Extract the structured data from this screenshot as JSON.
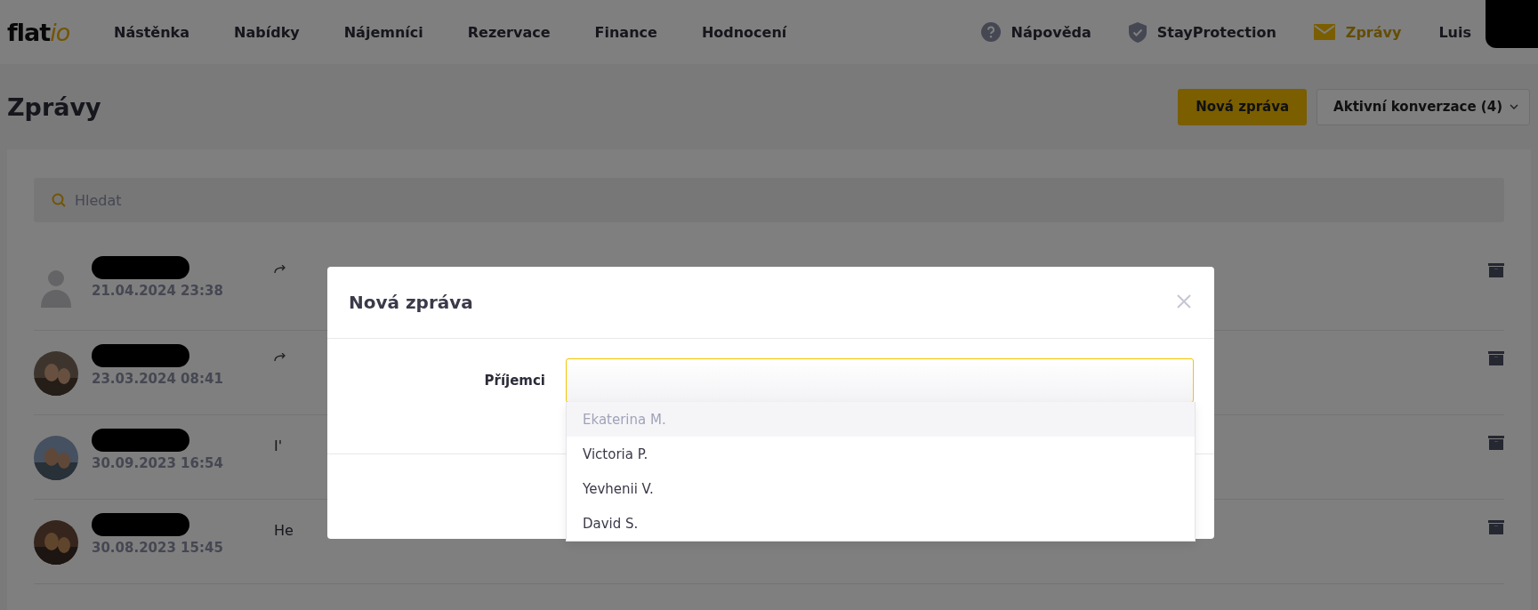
{
  "logo": {
    "main": "flat",
    "accent": "io"
  },
  "nav_links": [
    {
      "label": "Nástěnka",
      "selected": false
    },
    {
      "label": "Nabídky",
      "selected": false
    },
    {
      "label": "Nájemníci",
      "selected": false
    },
    {
      "label": "Rezervace",
      "selected": false
    },
    {
      "label": "Finance",
      "selected": false
    },
    {
      "label": "Hodnocení",
      "selected": false
    }
  ],
  "nav_right": [
    {
      "label": "Nápověda",
      "kind": "help",
      "selected": false
    },
    {
      "label": "StayProtection",
      "kind": "shield",
      "selected": false
    },
    {
      "label": "Zprávy",
      "kind": "mail",
      "selected": true
    }
  ],
  "user": {
    "name": "Luis"
  },
  "page_title": "Zprávy",
  "new_message_button": "Nová zpráva",
  "filter_dropdown": "Aktivní konverzace (4)",
  "search": {
    "placeholder": "Hledat"
  },
  "conversations": [
    {
      "kind": "silhouette",
      "date": "21.04.2024 23:38",
      "replied": true
    },
    {
      "kind": "picture",
      "date": "23.03.2024 08:41",
      "replied": true
    },
    {
      "kind": "picture",
      "date": "30.09.2023 16:54",
      "preview": "I'",
      "replied": false
    },
    {
      "kind": "picture",
      "date": "30.08.2023 15:45",
      "preview": "He",
      "replied": false
    }
  ],
  "modal": {
    "title": "Nová zpráva",
    "recipients_label": "Příjemci",
    "options": [
      {
        "label": "Ekaterina M.",
        "selected": true
      },
      {
        "label": "Victoria P.",
        "selected": false
      },
      {
        "label": "Yevhenii V.",
        "selected": false
      },
      {
        "label": "David S.",
        "selected": false
      }
    ]
  }
}
